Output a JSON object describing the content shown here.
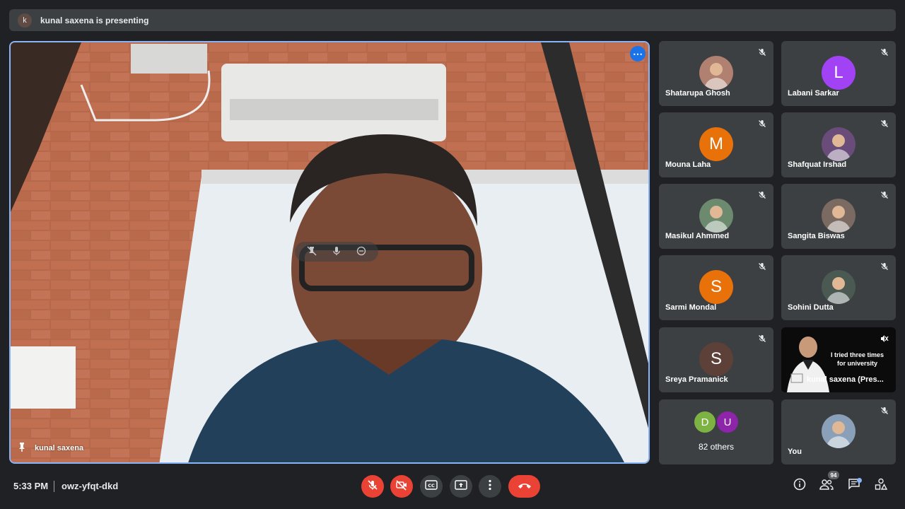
{
  "banner": {
    "avatar_letter": "k",
    "text": "kunal saxena is presenting"
  },
  "main_video": {
    "name": "kunal saxena"
  },
  "participants": [
    {
      "name": "Shatarupa Ghosh",
      "avatar_type": "photo",
      "avatar_color": "#b08070"
    },
    {
      "name": "Labani Sarkar",
      "avatar_type": "letter",
      "letter": "L",
      "avatar_color": "#a142f4"
    },
    {
      "name": "Mouna Laha",
      "avatar_type": "letter",
      "letter": "M",
      "avatar_color": "#e8710a"
    },
    {
      "name": "Shafquat Irshad",
      "avatar_type": "photo",
      "avatar_color": "#6a4c7a"
    },
    {
      "name": "Masikul Ahmmed",
      "avatar_type": "photo",
      "avatar_color": "#6b8a6e"
    },
    {
      "name": "Sangita Biswas",
      "avatar_type": "photo",
      "avatar_color": "#7a6a62"
    },
    {
      "name": "Sarmi Mondal",
      "avatar_type": "letter",
      "letter": "S",
      "avatar_color": "#e8710a"
    },
    {
      "name": "Sohini Dutta",
      "avatar_type": "photo",
      "avatar_color": "#4a5a52"
    },
    {
      "name": "Sreya Pramanick",
      "avatar_type": "letter",
      "letter": "S",
      "avatar_color": "#5d4037"
    },
    {
      "name": "kunal saxena (Pres...",
      "avatar_type": "video",
      "caption_line1": "I tried three times",
      "caption_line2": "for university"
    },
    {
      "name": "82 others",
      "avatar_type": "others",
      "letters": [
        "D",
        "U"
      ],
      "colors": [
        "#7cb342",
        "#8e24aa"
      ]
    },
    {
      "name": "You",
      "avatar_type": "photo",
      "avatar_color": "#8aa0b8"
    }
  ],
  "bottom_bar": {
    "time": "5:33 PM",
    "meeting_code": "owz-yfqt-dkd",
    "people_count": "94"
  },
  "colors": {
    "accent": "#8ab4f8",
    "danger": "#ea4335",
    "surface": "#3c4043",
    "background": "#202124"
  }
}
